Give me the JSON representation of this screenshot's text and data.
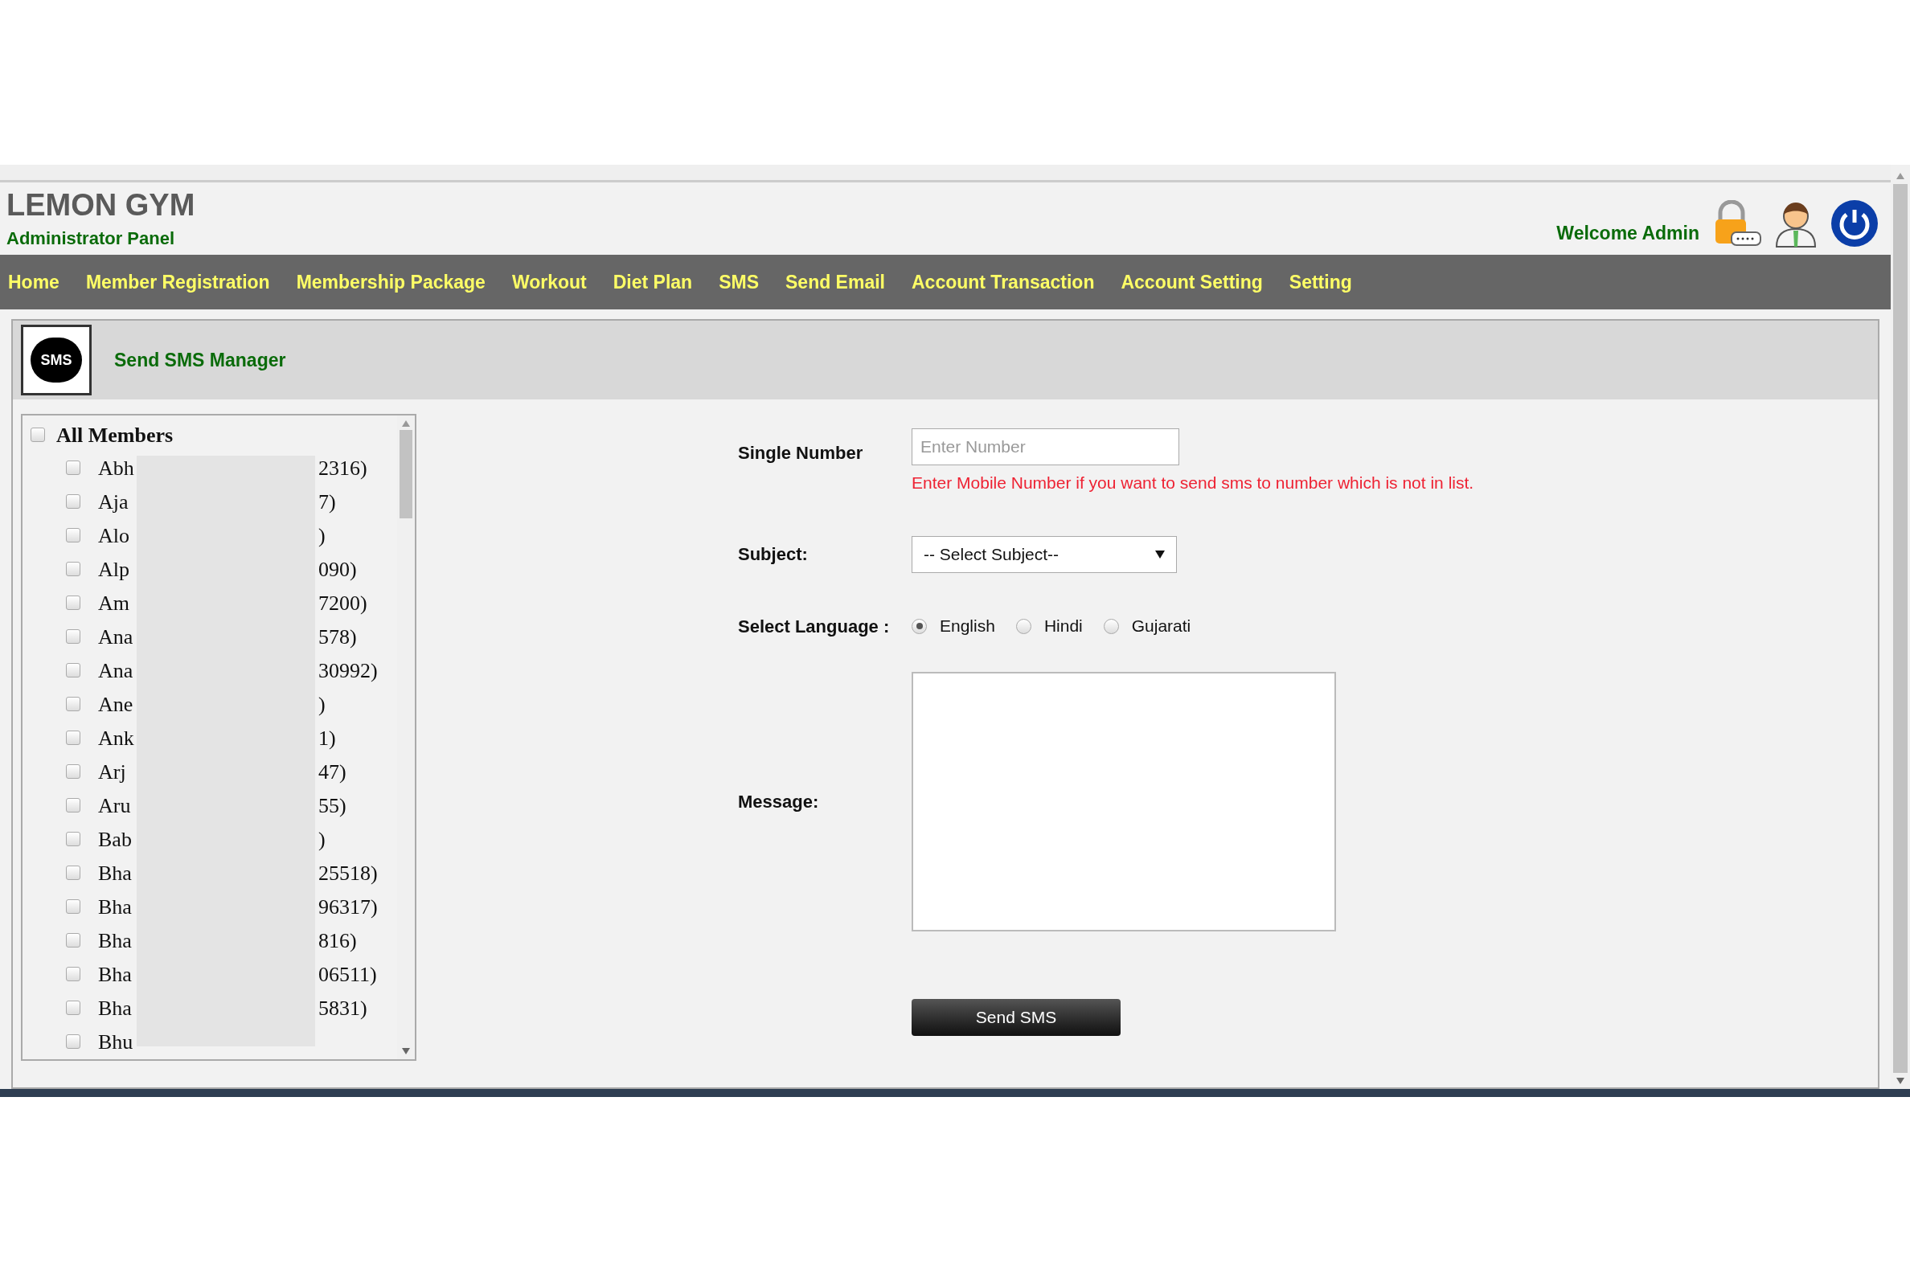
{
  "header": {
    "title": "LEMON GYM",
    "subtitle": "Administrator Panel",
    "welcome": "Welcome Admin"
  },
  "nav": [
    "Home",
    "Member Registration",
    "Membership Package",
    "Workout",
    "Diet Plan",
    "SMS",
    "Send Email",
    "Account Transaction",
    "Account Setting",
    "Setting"
  ],
  "panel": {
    "icon_label": "SMS",
    "title": "Send SMS Manager"
  },
  "members": {
    "all": {
      "label": "All Members",
      "checked": false
    },
    "items": [
      {
        "name": "Abh",
        "tail": "2316)",
        "checked": false
      },
      {
        "name": "Aja",
        "tail": "7)",
        "checked": false
      },
      {
        "name": "Alo",
        "tail": ")",
        "checked": false
      },
      {
        "name": "Alp",
        "tail": "090)",
        "checked": false
      },
      {
        "name": "Am",
        "tail": "7200)",
        "checked": false
      },
      {
        "name": "Ana",
        "tail": "578)",
        "checked": false
      },
      {
        "name": "Ana",
        "tail": "30992)",
        "checked": false
      },
      {
        "name": "Ane",
        "tail": ")",
        "checked": false
      },
      {
        "name": "Ank",
        "tail": "1)",
        "checked": false
      },
      {
        "name": "Arj",
        "tail": "47)",
        "checked": false
      },
      {
        "name": "Aru",
        "tail": "55)",
        "checked": false
      },
      {
        "name": "Bab",
        "tail": ")",
        "checked": false
      },
      {
        "name": "Bha",
        "tail": "25518)",
        "checked": false
      },
      {
        "name": "Bha",
        "tail": "96317)",
        "checked": false
      },
      {
        "name": "Bha",
        "tail": "816)",
        "checked": false
      },
      {
        "name": "Bha",
        "tail": "06511)",
        "checked": false
      },
      {
        "name": "Bha",
        "tail": "5831)",
        "checked": false
      },
      {
        "name": "Bhu",
        "checked": false
      }
    ]
  },
  "form": {
    "single_number": {
      "label": "Single Number",
      "placeholder": "Enter Number",
      "hint": "Enter Mobile Number if you want to send sms to number which is not in list."
    },
    "subject": {
      "label": "Subject:",
      "value": "-- Select Subject--"
    },
    "language": {
      "label": "Select Language :",
      "options": [
        {
          "label": "English",
          "selected": true
        },
        {
          "label": "Hindi",
          "selected": false
        },
        {
          "label": "Gujarati",
          "selected": false
        }
      ]
    },
    "message": {
      "label": "Message:"
    },
    "submit": "Send SMS"
  }
}
